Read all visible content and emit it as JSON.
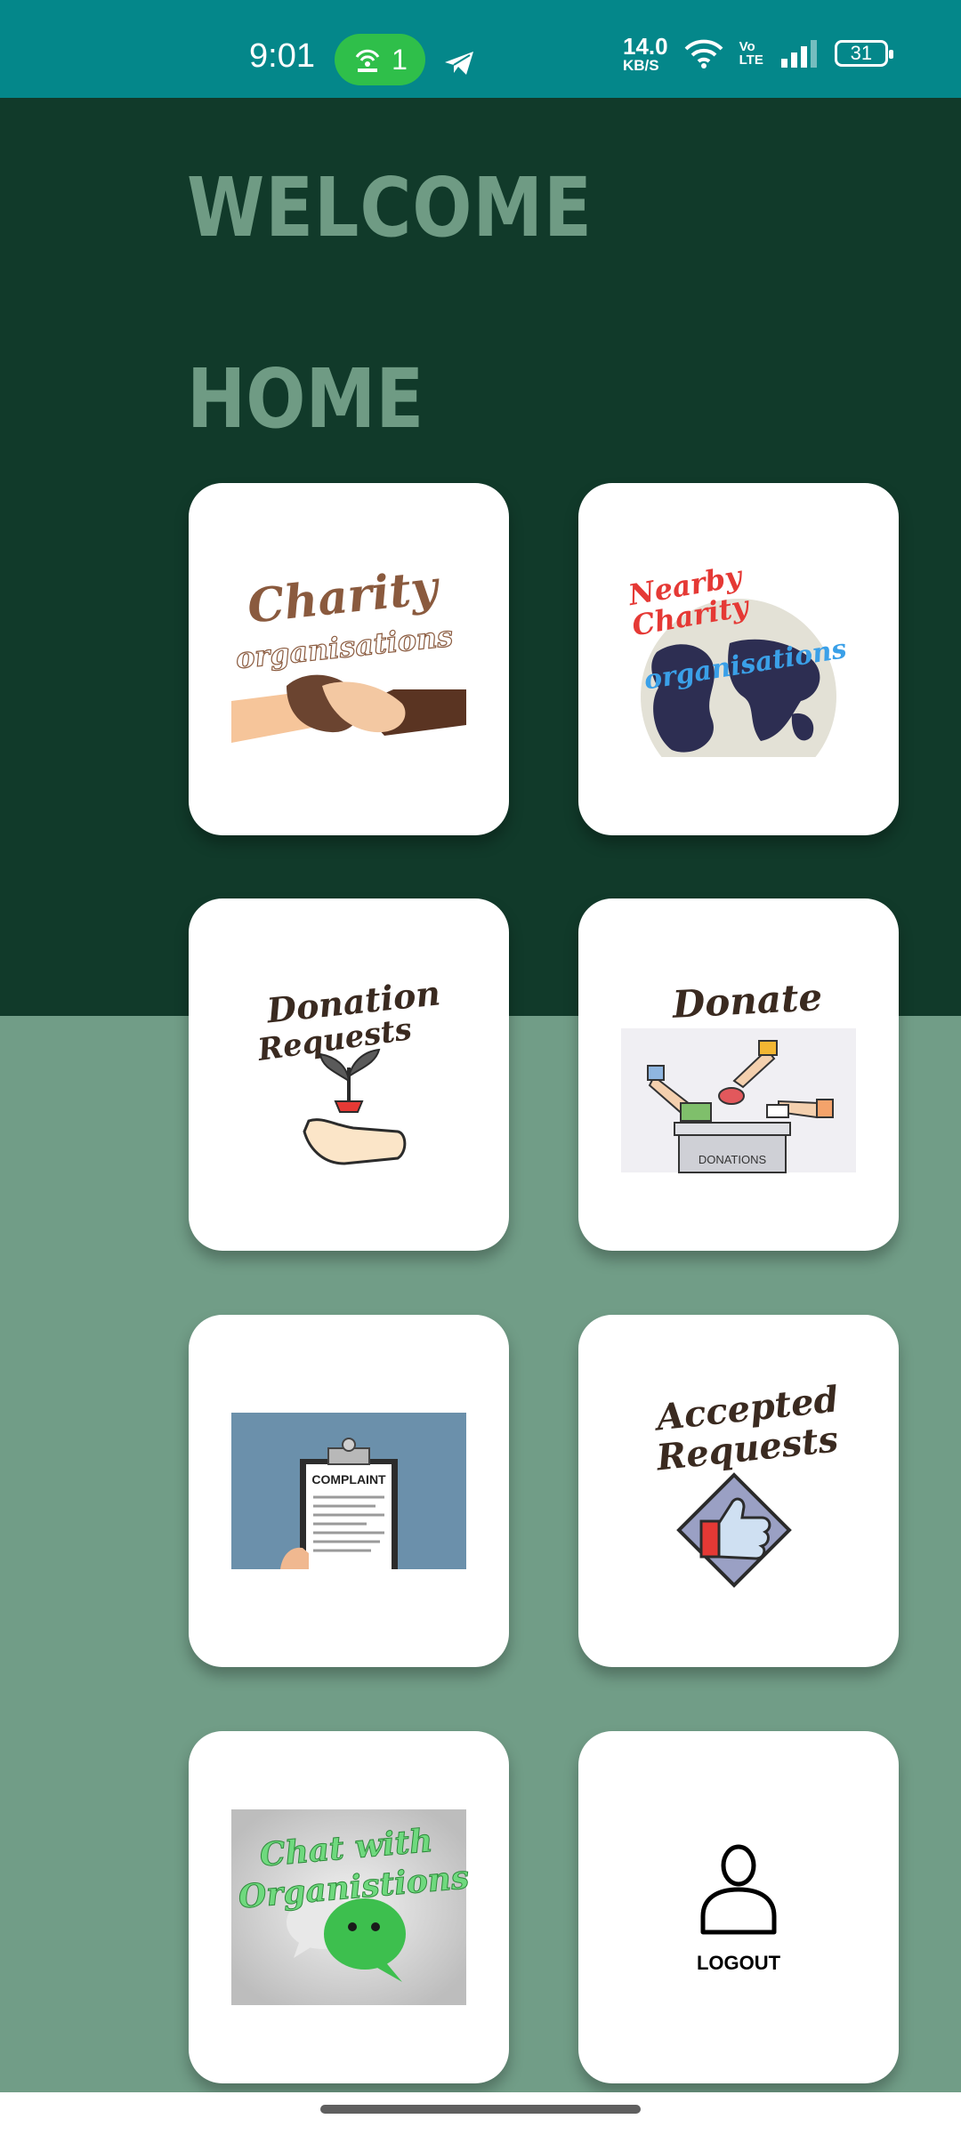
{
  "status_bar": {
    "time": "9:01",
    "hotspot_count": "1",
    "net_speed_value": "14.0",
    "net_speed_unit": "KB/S",
    "volte_top": "Vo",
    "volte_bottom": "LTE",
    "battery": "31",
    "colors": {
      "background": "#04878a",
      "hotspot": "#2fbf4a"
    }
  },
  "header": {
    "welcome": "WELCOME",
    "home": "HOME"
  },
  "tiles": {
    "charity": {
      "line1": "Charity",
      "line2": "organisations",
      "icon": "handshake-illustration"
    },
    "nearby": {
      "line1": "Nearby",
      "line2": "Charity",
      "line3": "organisations",
      "icon": "globe-illustration"
    },
    "donation_requests": {
      "line1": "Donation",
      "line2": "Requests",
      "icon": "sprout-in-hand-illustration"
    },
    "donate": {
      "title": "Donate",
      "box_label": "DONATIONS",
      "icon": "donation-box-illustration"
    },
    "complaint": {
      "label": "COMPLAINT",
      "icon": "clipboard-illustration"
    },
    "accepted": {
      "line1": "Accepted",
      "line2": "Requests",
      "icon": "thumbs-up-illustration"
    },
    "chat": {
      "line1": "Chat with",
      "line2": "Organistions",
      "icon": "chat-bubbles-illustration"
    },
    "logout": {
      "label": "LOGOUT",
      "icon": "user-icon"
    }
  },
  "colors": {
    "top_background": "#113a2a",
    "bottom_background": "#719d87",
    "heading": "#6f9b84",
    "card": "#ffffff"
  }
}
